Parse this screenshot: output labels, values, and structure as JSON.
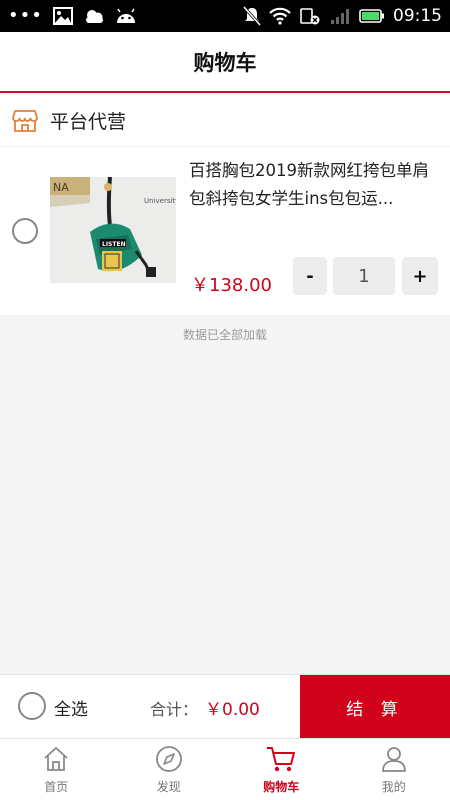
{
  "status_bar": {
    "time": "09:15"
  },
  "header": {
    "title": "购物车"
  },
  "shop": {
    "name": "平台代营"
  },
  "cart_items": [
    {
      "title": "百搭胸包2019新款网红挎包单肩包斜挎包女学生ins包包运...",
      "price": "￥138.00",
      "quantity": "1",
      "minus_label": "-",
      "plus_label": "+",
      "image_text": {
        "bag_label": "LISTEN",
        "shirt_text": "University",
        "sign_text": "NA"
      }
    }
  ],
  "loaded_note": "数据已全部加载",
  "footer": {
    "select_all": "全选",
    "total_label": "合计：",
    "total_value": "￥0.00",
    "checkout": "结 算"
  },
  "tabs": [
    {
      "label": "首页",
      "icon": "home-icon",
      "active": false
    },
    {
      "label": "发现",
      "icon": "compass-icon",
      "active": false
    },
    {
      "label": "购物车",
      "icon": "cart-icon",
      "active": true
    },
    {
      "label": "我的",
      "icon": "user-icon",
      "active": false
    }
  ],
  "colors": {
    "accent": "#d0021b",
    "shop_icon": "#e0803a",
    "tab_inactive": "#777777"
  }
}
